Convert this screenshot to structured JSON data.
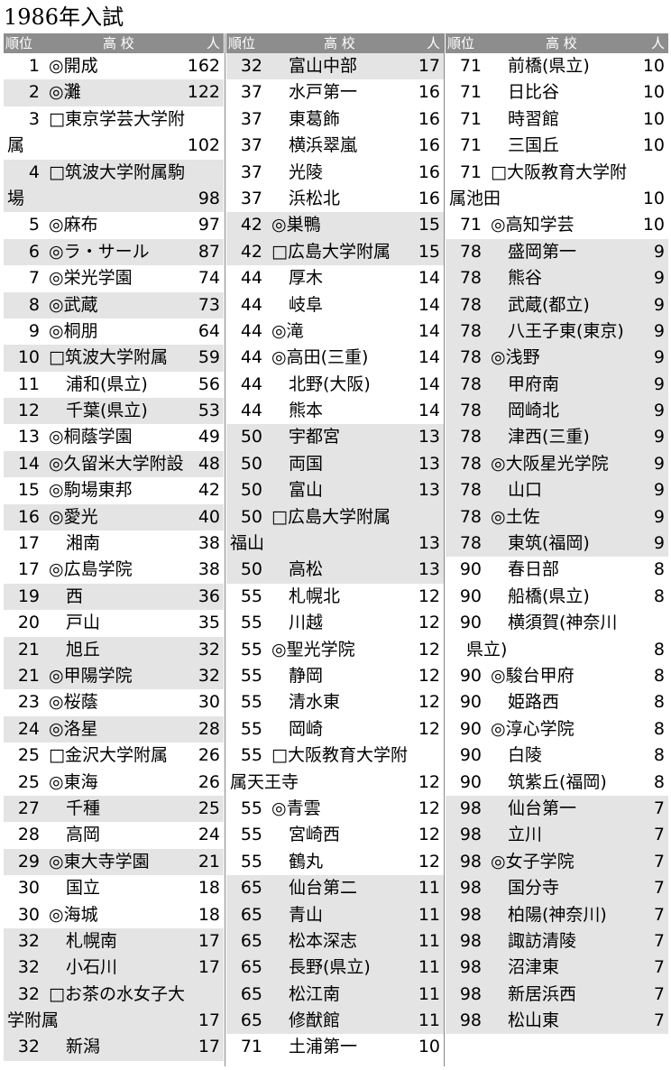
{
  "title": "1986年入試",
  "header": {
    "rank": "順位",
    "school": "高 校",
    "count": "人"
  },
  "columns": [
    [
      {
        "rank": "1",
        "school": "◎開成",
        "count": "162",
        "shade": false
      },
      {
        "rank": "2",
        "school": "◎灘",
        "count": "122",
        "shade": true
      },
      {
        "rank": "3",
        "school": "□東京学芸大学附",
        "count": "",
        "shade": false
      },
      {
        "rank": "",
        "school": "属",
        "count": "102",
        "shade": false
      },
      {
        "rank": "4",
        "school": "□筑波大学附属駒",
        "count": "",
        "shade": true
      },
      {
        "rank": "",
        "school": "場",
        "count": "98",
        "shade": true
      },
      {
        "rank": "5",
        "school": "◎麻布",
        "count": "97",
        "shade": false
      },
      {
        "rank": "6",
        "school": "◎ラ・サール",
        "count": "87",
        "shade": true
      },
      {
        "rank": "7",
        "school": "◎栄光学園",
        "count": "74",
        "shade": false
      },
      {
        "rank": "8",
        "school": "◎武蔵",
        "count": "73",
        "shade": true
      },
      {
        "rank": "9",
        "school": "◎桐朋",
        "count": "64",
        "shade": false
      },
      {
        "rank": "10",
        "school": "□筑波大学附属",
        "count": "59",
        "shade": true
      },
      {
        "rank": "11",
        "school": "　浦和(県立)",
        "count": "56",
        "shade": false
      },
      {
        "rank": "12",
        "school": "　千葉(県立)",
        "count": "53",
        "shade": true
      },
      {
        "rank": "13",
        "school": "◎桐蔭学園",
        "count": "49",
        "shade": false
      },
      {
        "rank": "14",
        "school": "◎久留米大学附設",
        "count": "48",
        "shade": true
      },
      {
        "rank": "15",
        "school": "◎駒場東邦",
        "count": "42",
        "shade": false
      },
      {
        "rank": "16",
        "school": "◎愛光",
        "count": "40",
        "shade": true
      },
      {
        "rank": "17",
        "school": "　湘南",
        "count": "38",
        "shade": false
      },
      {
        "rank": "17",
        "school": "◎広島学院",
        "count": "38",
        "shade": false
      },
      {
        "rank": "19",
        "school": "　西",
        "count": "36",
        "shade": true
      },
      {
        "rank": "20",
        "school": "　戸山",
        "count": "35",
        "shade": false
      },
      {
        "rank": "21",
        "school": "　旭丘",
        "count": "32",
        "shade": true
      },
      {
        "rank": "21",
        "school": "◎甲陽学院",
        "count": "32",
        "shade": true
      },
      {
        "rank": "23",
        "school": "◎桜蔭",
        "count": "30",
        "shade": false
      },
      {
        "rank": "24",
        "school": "◎洛星",
        "count": "28",
        "shade": true
      },
      {
        "rank": "25",
        "school": "□金沢大学附属",
        "count": "26",
        "shade": false
      },
      {
        "rank": "25",
        "school": "◎東海",
        "count": "26",
        "shade": false
      },
      {
        "rank": "27",
        "school": "　千種",
        "count": "25",
        "shade": true
      },
      {
        "rank": "28",
        "school": "　高岡",
        "count": "24",
        "shade": false
      },
      {
        "rank": "29",
        "school": "◎東大寺学園",
        "count": "21",
        "shade": true
      },
      {
        "rank": "30",
        "school": "　国立",
        "count": "18",
        "shade": false
      },
      {
        "rank": "30",
        "school": "◎海城",
        "count": "18",
        "shade": false
      },
      {
        "rank": "32",
        "school": "　札幌南",
        "count": "17",
        "shade": true
      },
      {
        "rank": "32",
        "school": "　小石川",
        "count": "17",
        "shade": true
      },
      {
        "rank": "32",
        "school": "□お茶の水女子大",
        "count": "",
        "shade": true
      },
      {
        "rank": "",
        "school": "学附属",
        "count": "17",
        "shade": true
      },
      {
        "rank": "32",
        "school": "　新潟",
        "count": "17",
        "shade": true
      }
    ],
    [
      {
        "rank": "32",
        "school": "　富山中部",
        "count": "17",
        "shade": true
      },
      {
        "rank": "37",
        "school": "　水戸第一",
        "count": "16",
        "shade": false
      },
      {
        "rank": "37",
        "school": "　東葛飾",
        "count": "16",
        "shade": false
      },
      {
        "rank": "37",
        "school": "　横浜翠嵐",
        "count": "16",
        "shade": false
      },
      {
        "rank": "37",
        "school": "　光陵",
        "count": "16",
        "shade": false
      },
      {
        "rank": "37",
        "school": "　浜松北",
        "count": "16",
        "shade": false
      },
      {
        "rank": "42",
        "school": "◎巣鴨",
        "count": "15",
        "shade": true
      },
      {
        "rank": "42",
        "school": "□広島大学附属",
        "count": "15",
        "shade": true
      },
      {
        "rank": "44",
        "school": "　厚木",
        "count": "14",
        "shade": false
      },
      {
        "rank": "44",
        "school": "　岐阜",
        "count": "14",
        "shade": false
      },
      {
        "rank": "44",
        "school": "◎滝",
        "count": "14",
        "shade": false
      },
      {
        "rank": "44",
        "school": "◎高田(三重)",
        "count": "14",
        "shade": false
      },
      {
        "rank": "44",
        "school": "　北野(大阪)",
        "count": "14",
        "shade": false
      },
      {
        "rank": "44",
        "school": "　熊本",
        "count": "14",
        "shade": false
      },
      {
        "rank": "50",
        "school": "　宇都宮",
        "count": "13",
        "shade": true
      },
      {
        "rank": "50",
        "school": "　両国",
        "count": "13",
        "shade": true
      },
      {
        "rank": "50",
        "school": "　富山",
        "count": "13",
        "shade": true
      },
      {
        "rank": "50",
        "school": "□広島大学附属",
        "count": "",
        "shade": true
      },
      {
        "rank": "",
        "school": "福山",
        "count": "13",
        "shade": true
      },
      {
        "rank": "50",
        "school": "　高松",
        "count": "13",
        "shade": true
      },
      {
        "rank": "55",
        "school": "　札幌北",
        "count": "12",
        "shade": false
      },
      {
        "rank": "55",
        "school": "　川越",
        "count": "12",
        "shade": false
      },
      {
        "rank": "55",
        "school": "◎聖光学院",
        "count": "12",
        "shade": false
      },
      {
        "rank": "55",
        "school": "　静岡",
        "count": "12",
        "shade": false
      },
      {
        "rank": "55",
        "school": "　清水東",
        "count": "12",
        "shade": false
      },
      {
        "rank": "55",
        "school": "　岡崎",
        "count": "12",
        "shade": false
      },
      {
        "rank": "55",
        "school": "□大阪教育大学附",
        "count": "",
        "shade": false
      },
      {
        "rank": "",
        "school": "属天王寺",
        "count": "12",
        "shade": false
      },
      {
        "rank": "55",
        "school": "◎青雲",
        "count": "12",
        "shade": false
      },
      {
        "rank": "55",
        "school": "　宮崎西",
        "count": "12",
        "shade": false
      },
      {
        "rank": "55",
        "school": "　鶴丸",
        "count": "12",
        "shade": false
      },
      {
        "rank": "65",
        "school": "　仙台第二",
        "count": "11",
        "shade": true
      },
      {
        "rank": "65",
        "school": "　青山",
        "count": "11",
        "shade": true
      },
      {
        "rank": "65",
        "school": "　松本深志",
        "count": "11",
        "shade": true
      },
      {
        "rank": "65",
        "school": "　長野(県立)",
        "count": "11",
        "shade": true
      },
      {
        "rank": "65",
        "school": "　松江南",
        "count": "11",
        "shade": true
      },
      {
        "rank": "65",
        "school": "　修猷館",
        "count": "11",
        "shade": true
      },
      {
        "rank": "71",
        "school": "　土浦第一",
        "count": "10",
        "shade": false
      }
    ],
    [
      {
        "rank": "71",
        "school": "　前橋(県立)",
        "count": "10",
        "shade": false
      },
      {
        "rank": "71",
        "school": "　日比谷",
        "count": "10",
        "shade": false
      },
      {
        "rank": "71",
        "school": "　時習館",
        "count": "10",
        "shade": false
      },
      {
        "rank": "71",
        "school": "　三国丘",
        "count": "10",
        "shade": false
      },
      {
        "rank": "71",
        "school": "□大阪教育大学附",
        "count": "",
        "shade": false
      },
      {
        "rank": "",
        "school": "属池田",
        "count": "10",
        "shade": false
      },
      {
        "rank": "71",
        "school": "◎高知学芸",
        "count": "10",
        "shade": false
      },
      {
        "rank": "78",
        "school": "　盛岡第一",
        "count": "9",
        "shade": true
      },
      {
        "rank": "78",
        "school": "　熊谷",
        "count": "9",
        "shade": true
      },
      {
        "rank": "78",
        "school": "　武蔵(都立)",
        "count": "9",
        "shade": true
      },
      {
        "rank": "78",
        "school": "　八王子東(東京)",
        "count": "9",
        "shade": true
      },
      {
        "rank": "78",
        "school": "◎浅野",
        "count": "9",
        "shade": true
      },
      {
        "rank": "78",
        "school": "　甲府南",
        "count": "9",
        "shade": true
      },
      {
        "rank": "78",
        "school": "　岡崎北",
        "count": "9",
        "shade": true
      },
      {
        "rank": "78",
        "school": "　津西(三重)",
        "count": "9",
        "shade": true
      },
      {
        "rank": "78",
        "school": "◎大阪星光学院",
        "count": "9",
        "shade": true
      },
      {
        "rank": "78",
        "school": "　山口",
        "count": "9",
        "shade": true
      },
      {
        "rank": "78",
        "school": "◎土佐",
        "count": "9",
        "shade": true
      },
      {
        "rank": "78",
        "school": "　東筑(福岡)",
        "count": "9",
        "shade": true
      },
      {
        "rank": "90",
        "school": "　春日部",
        "count": "8",
        "shade": false
      },
      {
        "rank": "90",
        "school": "　船橋(県立)",
        "count": "8",
        "shade": false
      },
      {
        "rank": "90",
        "school": "　横須賀(神奈川",
        "count": "",
        "shade": false
      },
      {
        "rank": "",
        "school": "　県立)",
        "count": "8",
        "shade": false
      },
      {
        "rank": "90",
        "school": "◎駿台甲府",
        "count": "8",
        "shade": false
      },
      {
        "rank": "90",
        "school": "　姫路西",
        "count": "8",
        "shade": false
      },
      {
        "rank": "90",
        "school": "◎淳心学院",
        "count": "8",
        "shade": false
      },
      {
        "rank": "90",
        "school": "　白陵",
        "count": "8",
        "shade": false
      },
      {
        "rank": "90",
        "school": "　筑紫丘(福岡)",
        "count": "8",
        "shade": false
      },
      {
        "rank": "98",
        "school": "　仙台第一",
        "count": "7",
        "shade": true
      },
      {
        "rank": "98",
        "school": "　立川",
        "count": "7",
        "shade": true
      },
      {
        "rank": "98",
        "school": "◎女子学院",
        "count": "7",
        "shade": true
      },
      {
        "rank": "98",
        "school": "　国分寺",
        "count": "7",
        "shade": true
      },
      {
        "rank": "98",
        "school": "　柏陽(神奈川)",
        "count": "7",
        "shade": true
      },
      {
        "rank": "98",
        "school": "　諏訪清陵",
        "count": "7",
        "shade": true
      },
      {
        "rank": "98",
        "school": "　沼津東",
        "count": "7",
        "shade": true
      },
      {
        "rank": "98",
        "school": "　新居浜西",
        "count": "7",
        "shade": true
      },
      {
        "rank": "98",
        "school": "　松山東",
        "count": "7",
        "shade": true
      }
    ]
  ]
}
